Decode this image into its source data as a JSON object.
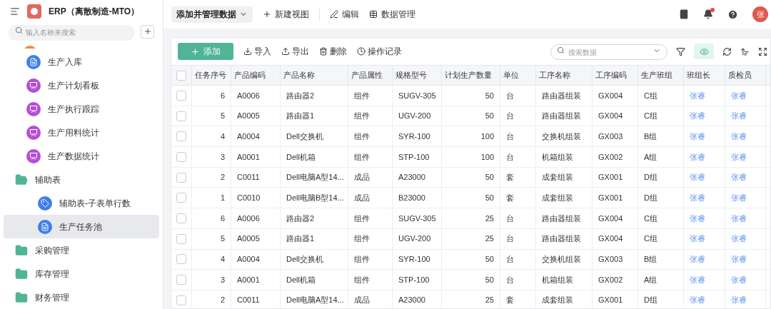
{
  "app": {
    "title": "ERP（离散制造-MTO）"
  },
  "sidebar": {
    "search_placeholder": "输入名称来搜索",
    "items": [
      {
        "kind": "doc",
        "label": "生产入库",
        "selected": false
      },
      {
        "kind": "board",
        "label": "生产计划看板",
        "selected": false
      },
      {
        "kind": "board",
        "label": "生产执行跟踪",
        "selected": false
      },
      {
        "kind": "board",
        "label": "生产用料统计",
        "selected": false
      },
      {
        "kind": "board",
        "label": "生产数据统计",
        "selected": false
      },
      {
        "kind": "folder",
        "label": "辅助表",
        "selected": false,
        "expanded": true,
        "children": [
          {
            "kind": "tag",
            "label": "辅助表-子表单行数",
            "selected": false
          },
          {
            "kind": "doc",
            "label": "生产任务池",
            "selected": true
          }
        ]
      },
      {
        "kind": "folder",
        "label": "采购管理",
        "selected": false,
        "expanded": false
      },
      {
        "kind": "folder",
        "label": "库存管理",
        "selected": false,
        "expanded": false
      },
      {
        "kind": "folder",
        "label": "财务管理",
        "selected": false,
        "expanded": false
      }
    ]
  },
  "topbar": {
    "view_dropdown": "添加并管理数据",
    "actions": [
      {
        "kind": "plus",
        "label": "新建视图"
      },
      {
        "kind": "edit",
        "label": "编辑"
      },
      {
        "kind": "table",
        "label": "数据管理"
      }
    ],
    "notification_unread": true,
    "avatar": "张"
  },
  "toolbar": {
    "add_button": "添加",
    "actions": [
      {
        "kind": "import",
        "label": "导入"
      },
      {
        "kind": "export",
        "label": "导出"
      },
      {
        "kind": "delete",
        "label": "删除"
      },
      {
        "kind": "history",
        "label": "操作记录"
      }
    ],
    "search_placeholder": "搜索数据"
  },
  "table": {
    "all_checked": false,
    "columns": [
      {
        "label": "任务序号",
        "kind": "number"
      },
      {
        "label": "产品编码",
        "kind": "text"
      },
      {
        "label": "产品名称",
        "kind": "text"
      },
      {
        "label": "产品属性",
        "kind": "text"
      },
      {
        "label": "规格型号",
        "kind": "text"
      },
      {
        "label": "计划生产数量",
        "kind": "number"
      },
      {
        "label": "单位",
        "kind": "text"
      },
      {
        "label": "工序名称",
        "kind": "text"
      },
      {
        "label": "工序编码",
        "kind": "text"
      },
      {
        "label": "生产班组",
        "kind": "text"
      },
      {
        "label": "班组长",
        "kind": "person"
      },
      {
        "label": "质检员",
        "kind": "person"
      }
    ],
    "rows": [
      {
        "checked": false,
        "cells": [
          "6",
          "A0006",
          "路由器2",
          "组件",
          "SUGV-305",
          "50",
          "台",
          "路由器组装",
          "GX004",
          "C组",
          "张睿",
          "张睿"
        ]
      },
      {
        "checked": false,
        "cells": [
          "5",
          "A0005",
          "路由器1",
          "组件",
          "UGV-200",
          "50",
          "台",
          "路由器组装",
          "GX004",
          "C组",
          "张睿",
          "张睿"
        ]
      },
      {
        "checked": false,
        "cells": [
          "4",
          "A0004",
          "Dell交换机",
          "组件",
          "SYR-100",
          "100",
          "台",
          "交换机组装",
          "GX003",
          "B组",
          "张睿",
          "张睿"
        ]
      },
      {
        "checked": false,
        "cells": [
          "3",
          "A0001",
          "Dell机箱",
          "组件",
          "STP-100",
          "100",
          "台",
          "机箱组装",
          "GX002",
          "A组",
          "张睿",
          "张睿"
        ]
      },
      {
        "checked": false,
        "cells": [
          "2",
          "C0011",
          "Dell电脑A型14...",
          "成品",
          "A23000",
          "50",
          "套",
          "成套组装",
          "GX001",
          "D组",
          "张睿",
          "张睿"
        ]
      },
      {
        "checked": false,
        "cells": [
          "1",
          "C0010",
          "Dell电脑B型14...",
          "成品",
          "B23000",
          "50",
          "套",
          "成套组装",
          "GX001",
          "D组",
          "张睿",
          "张睿"
        ]
      },
      {
        "checked": false,
        "cells": [
          "6",
          "A0006",
          "路由器2",
          "组件",
          "SUGV-305",
          "25",
          "台",
          "路由器组装",
          "GX004",
          "C组",
          "张睿",
          "张睿"
        ]
      },
      {
        "checked": false,
        "cells": [
          "5",
          "A0005",
          "路由器1",
          "组件",
          "UGV-200",
          "25",
          "台",
          "路由器组装",
          "GX004",
          "C组",
          "张睿",
          "张睿"
        ]
      },
      {
        "checked": false,
        "cells": [
          "4",
          "A0004",
          "Dell交换机",
          "组件",
          "SYR-100",
          "50",
          "台",
          "交换机组装",
          "GX003",
          "B组",
          "张睿",
          "张睿"
        ]
      },
      {
        "checked": false,
        "cells": [
          "3",
          "A0001",
          "Dell机箱",
          "组件",
          "STP-100",
          "50",
          "台",
          "机箱组装",
          "GX002",
          "A组",
          "张睿",
          "张睿"
        ]
      },
      {
        "checked": false,
        "cells": [
          "2",
          "C0011",
          "Dell电脑A型14...",
          "成品",
          "A23000",
          "25",
          "套",
          "成套组装",
          "GX001",
          "D组",
          "张睿",
          "张睿"
        ]
      }
    ]
  }
}
